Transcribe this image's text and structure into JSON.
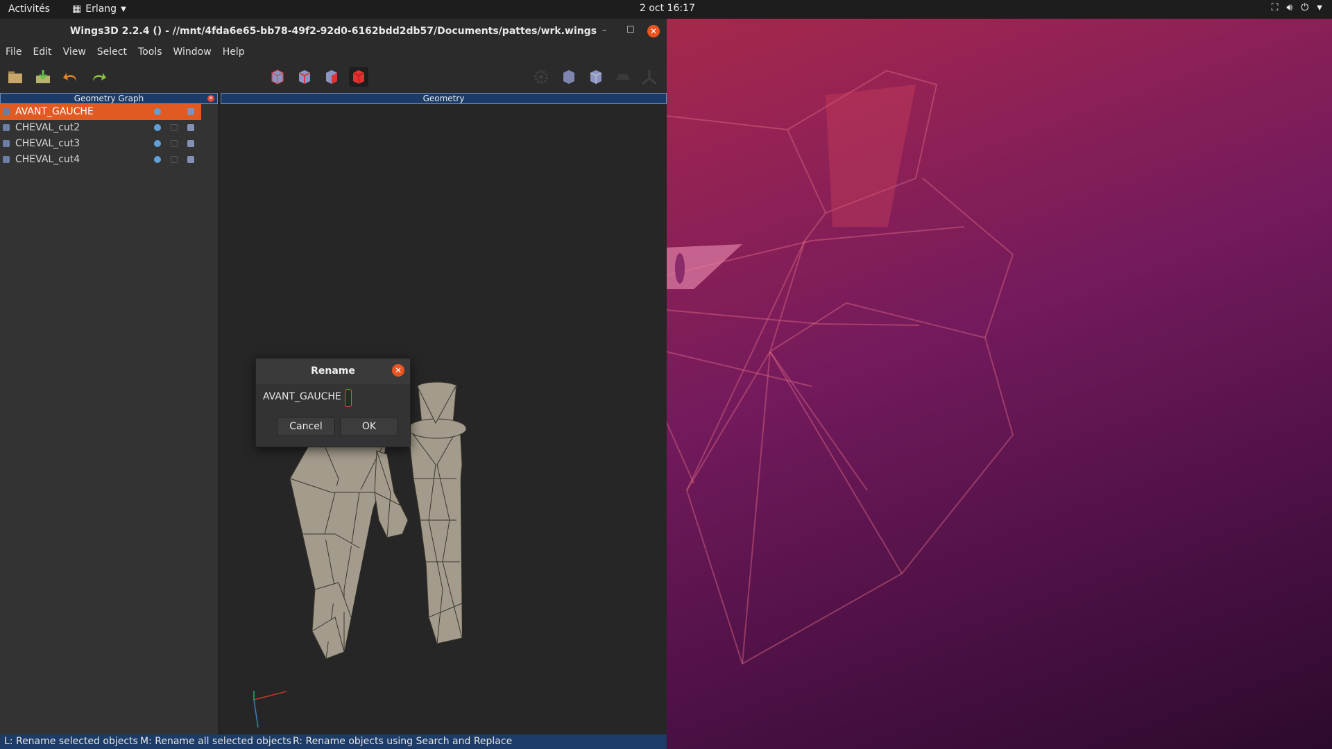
{
  "topbar": {
    "activities": "Activités",
    "app_name": "Erlang",
    "clock": "2 oct  16:17"
  },
  "window": {
    "title": "Wings3D 2.2.4 () - //mnt/4fda6e65-bb78-49f2-92d0-6162bdd2db57/Documents/pattes/wrk.wings",
    "menu": [
      "File",
      "Edit",
      "View",
      "Select",
      "Tools",
      "Window",
      "Help"
    ]
  },
  "geometry_graph": {
    "header": "Geometry Graph",
    "objects": [
      {
        "name": "AVANT_GAUCHE",
        "selected": true
      },
      {
        "name": "CHEVAL_cut2",
        "selected": false
      },
      {
        "name": "CHEVAL_cut3",
        "selected": false
      },
      {
        "name": "CHEVAL_cut4",
        "selected": false
      }
    ]
  },
  "geometry": {
    "header": "Geometry"
  },
  "dialog": {
    "title": "Rename",
    "label": "AVANT_GAUCHE",
    "input_value": "",
    "cancel": "Cancel",
    "ok": "OK"
  },
  "statusbar": {
    "left": "L: Rename selected objects",
    "middle": "M: Rename all selected objects",
    "right": "R: Rename objects using Search and Replace"
  },
  "colors": {
    "accent": "#e95420",
    "selected_row": "#e15a22",
    "panel_header": "#1c3b66",
    "mesh": "#a39b8b"
  }
}
